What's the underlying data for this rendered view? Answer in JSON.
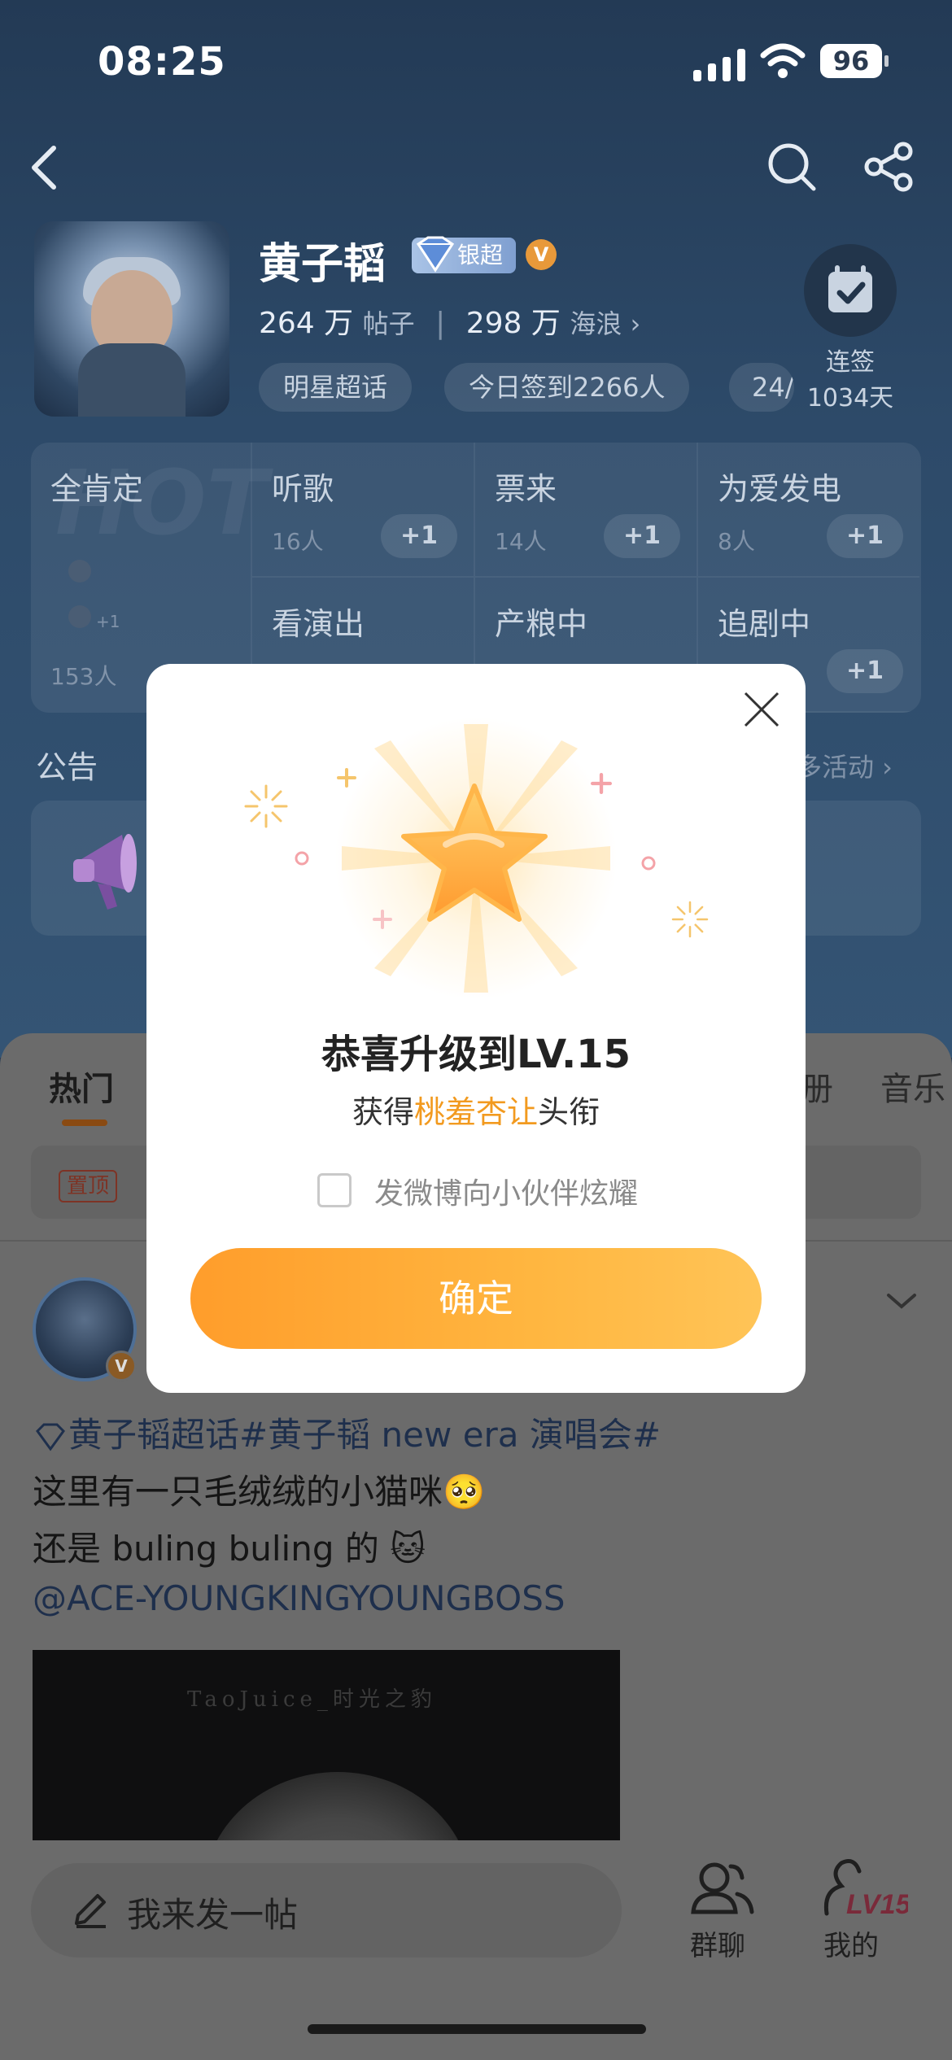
{
  "status_bar": {
    "time": "08:25",
    "battery": "96"
  },
  "header": {
    "star_name": "黄子韬",
    "level_tag": "银超",
    "verified": "V",
    "posts_count": "264 万",
    "posts_label": "帖子",
    "waves_count": "298 万",
    "waves_label": "海浪 ›",
    "chips": [
      "明星超话",
      "今日签到2266人",
      "24/"
    ],
    "checkin_label": "连签",
    "checkin_days": "1034天"
  },
  "activity_grid": {
    "first": {
      "title": "全肯定",
      "plus": "+1",
      "count": "153人"
    },
    "cells": [
      {
        "title": "听歌",
        "count": "16人",
        "plus": "+1"
      },
      {
        "title": "票来",
        "count": "14人",
        "plus": "+1"
      },
      {
        "title": "为爱发电",
        "count": "8人",
        "plus": "+1"
      },
      {
        "title": "看演出",
        "count": "",
        "plus": ""
      },
      {
        "title": "产粮中",
        "count": "",
        "plus": ""
      },
      {
        "title": "追剧中",
        "count": "",
        "plus": "+1"
      }
    ],
    "watermark": "HOT"
  },
  "notice": {
    "title": "公告",
    "more": "多活动 ›"
  },
  "tabs": [
    {
      "label": "热门",
      "active": true
    },
    {
      "label": "册",
      "active": false
    },
    {
      "label": "音乐",
      "active": false
    }
  ],
  "pin_label": "置顶",
  "post": {
    "verified": "V",
    "line1": "黄子韬超话#黄子韬 new era 演唱会#",
    "line2": "这里有一只毛绒绒的小猫咪🥺",
    "line3": "还是 buling buling 的 🐱",
    "line4": "@ACE-YOUNGKINGYOUNGBOSS",
    "image_watermark": "TaoJuice_时光之豹"
  },
  "bottom": {
    "compose_text": "我来发一帖",
    "group_label": "群聊",
    "mine_label": "我的",
    "mine_level": "LV15"
  },
  "modal": {
    "title": "恭喜升级到LV.15",
    "sub_prefix": "获得",
    "sub_highlight": "桃羞杏让",
    "sub_suffix": "头衔",
    "share_label": "发微博向小伙伴炫耀",
    "confirm_label": "确定"
  },
  "colors": {
    "accent": "#ffa42f",
    "highlight": "#f29a1f",
    "blue_link": "#4e7bd6"
  }
}
